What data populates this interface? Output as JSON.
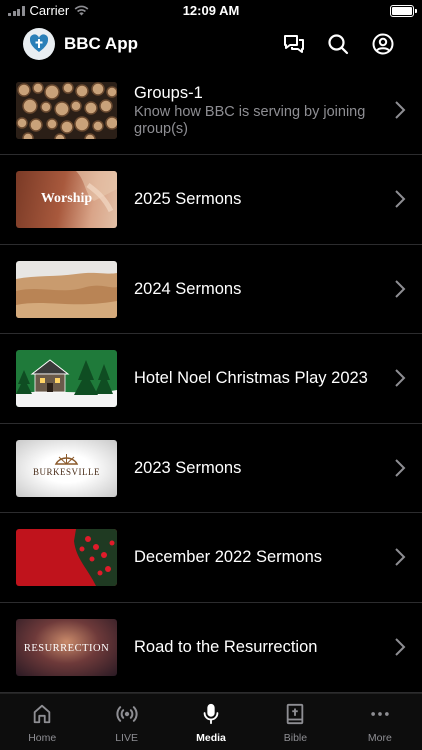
{
  "status_bar": {
    "carrier": "Carrier",
    "time": "12:09 AM"
  },
  "header": {
    "title": "BBC App"
  },
  "items": [
    {
      "title": "Groups-1",
      "subtitle": "Know how BBC is serving by joining group(s)"
    },
    {
      "title": "2025 Sermons",
      "thumb_text": "Worship"
    },
    {
      "title": "2024 Sermons"
    },
    {
      "title": "Hotel Noel Christmas Play 2023"
    },
    {
      "title": "2023 Sermons",
      "thumb_text": "BURKESVILLE"
    },
    {
      "title": "December 2022 Sermons"
    },
    {
      "title": "Road to the Resurrection",
      "thumb_text": "RESURRECTION"
    }
  ],
  "tabs": [
    {
      "label": "Home",
      "icon": "home-icon"
    },
    {
      "label": "LIVE",
      "icon": "live-broadcast-icon"
    },
    {
      "label": "Media",
      "icon": "microphone-icon"
    },
    {
      "label": "Bible",
      "icon": "bible-icon"
    },
    {
      "label": "More",
      "icon": "more-dots-icon"
    }
  ],
  "active_tab": "Media"
}
